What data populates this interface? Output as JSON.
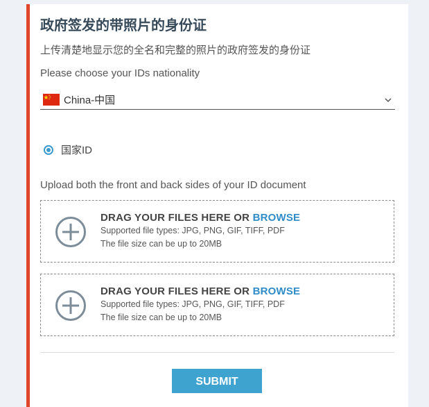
{
  "form": {
    "title": "政府签发的带照片的身份证",
    "subtitle": "上传清楚地显示您的全名和完整的照片的政府签发的身份证",
    "nationality_label": "Please choose your IDs nationality",
    "nationality_value": "China-中国",
    "document_type_option": "国家ID",
    "upload_label": "Upload both the front and back sides of your ID document",
    "submit_label": "SUBMIT"
  },
  "dropzones": [
    {
      "heading_prefix": "DRAG YOUR FILES HERE OR",
      "browse_label": "BROWSE",
      "types": "Supported file types: JPG, PNG, GIF, TIFF, PDF",
      "size": "The file size can be up to 20MB"
    },
    {
      "heading_prefix": "DRAG YOUR FILES HERE OR",
      "browse_label": "BROWSE",
      "types": "Supported file types: JPG, PNG, GIF, TIFF, PDF",
      "size": "The file size can be up to 20MB"
    }
  ],
  "icons": {
    "flag": "china-flag-icon",
    "dropdown": "chevron-down-icon",
    "upload": "plus-circle-icon"
  },
  "colors": {
    "accent_border": "#e0462b",
    "link": "#2e8cc8",
    "submit_bg": "#3fa3d0",
    "radio": "#3a9bcf"
  }
}
